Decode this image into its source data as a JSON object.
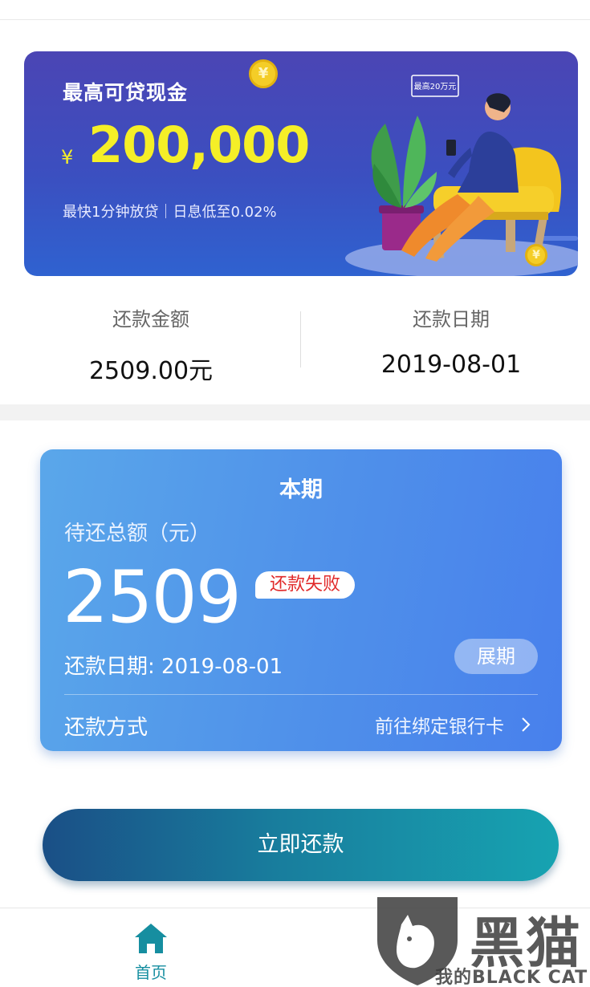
{
  "banner": {
    "title": "最高可贷现金",
    "currency": "¥",
    "amount": "200,000",
    "subtitle": "最快1分钟放贷｜日息低至0.02%",
    "bubble_text": "最高20万元",
    "coin_symbol": "¥"
  },
  "summary": {
    "amount_label": "还款金额",
    "amount_value": "2509.00元",
    "date_label": "还款日期",
    "date_value": "2019-08-01"
  },
  "card": {
    "title": "本期",
    "subtitle": "待还总额（元）",
    "amount": "2509",
    "status": "还款失败",
    "date_line": "还款日期: 2019-08-01",
    "extend_label": "展期",
    "method_label": "还款方式",
    "method_link": "前往绑定银行卡"
  },
  "pay_button": "立即还款",
  "nav": {
    "home_label": "首页"
  },
  "watermark": {
    "cn": "黑猫",
    "en": "我的BLACK CAT"
  },
  "colors": {
    "banner_yellow": "#f5ef27",
    "status_red": "#e12a2a",
    "nav_active": "#168ea0",
    "card_blue": "#4f90ea"
  }
}
